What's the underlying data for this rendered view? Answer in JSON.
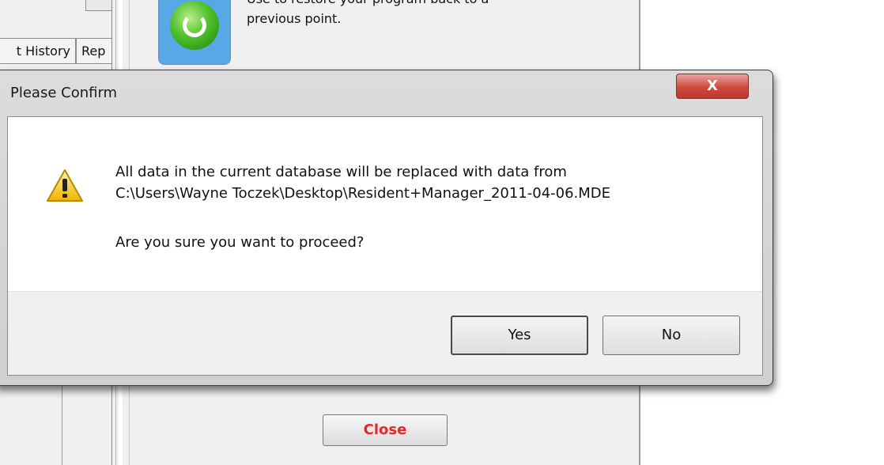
{
  "background": {
    "tabs": [
      "t History",
      "Rep"
    ],
    "description_top": "Use to restore your program back to a",
    "description_line2": "previous point.",
    "close_label": "Close"
  },
  "dialog": {
    "title": "Please Confirm",
    "close_symbol": "X",
    "message_line1": "All data in the current database will be replaced with data from",
    "message_line2": "C:\\Users\\Wayne Toczek\\Desktop\\Resident+Manager_2011-04-06.MDE",
    "question": "Are you sure you want to proceed?",
    "yes_label": "Yes",
    "no_label": "No"
  },
  "colors": {
    "close_text": "#e8272a",
    "dialog_close_button": "#c74537",
    "warning": "#f5c400"
  },
  "icons": {
    "restore": "restore-icon",
    "warning": "warning-icon"
  }
}
